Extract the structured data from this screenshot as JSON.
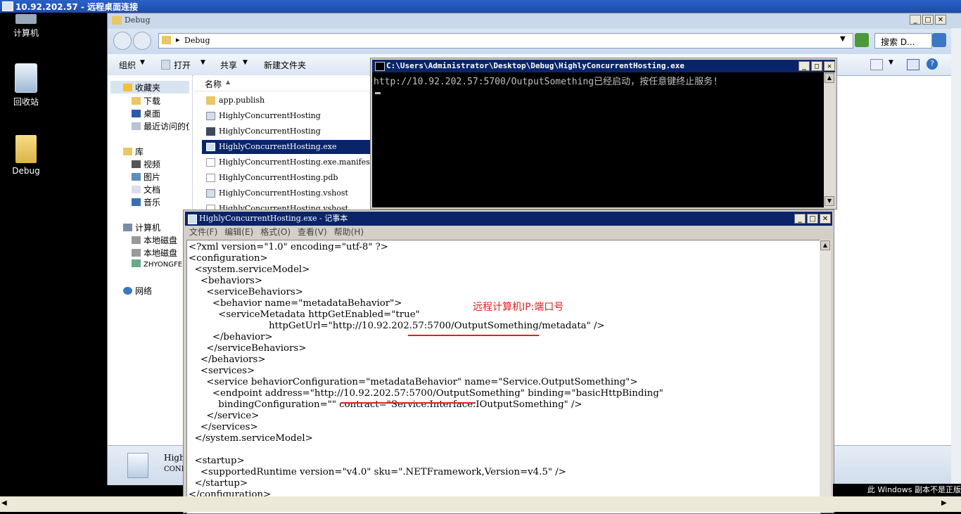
{
  "rdp": {
    "title": "10.92.202.57 - 远程桌面连接"
  },
  "desktop": {
    "icons": [
      {
        "label": "计算机"
      },
      {
        "label": "回收站"
      },
      {
        "label": "Debug"
      }
    ],
    "watermark": "此 Windows 副本不是正版"
  },
  "explorer": {
    "title": "Debug",
    "address": "Debug",
    "search_placeholder": "搜索 D...",
    "commands": [
      "组织",
      "打开",
      "共享",
      "新建文件夹"
    ],
    "column_name": "名称",
    "nav": {
      "favorites": {
        "label": "收藏夹",
        "items": [
          "下载",
          "桌面",
          "最近访问的位置"
        ]
      },
      "library": {
        "label": "库",
        "items": [
          "视频",
          "图片",
          "文档",
          "音乐"
        ]
      },
      "computer": {
        "label": "计算机",
        "items": [
          "本地磁盘",
          "本地磁盘",
          "ZHYONGFEN"
        ]
      },
      "network": {
        "label": "网络"
      }
    },
    "files": [
      {
        "name": "app.publish",
        "type": "folder"
      },
      {
        "name": "HighlyConcurrentHosting",
        "type": "app"
      },
      {
        "name": "HighlyConcurrentHosting",
        "type": "window"
      },
      {
        "name": "HighlyConcurrentHosting.exe",
        "type": "config",
        "selected": true
      },
      {
        "name": "HighlyConcurrentHosting.exe.manifest",
        "type": "file"
      },
      {
        "name": "HighlyConcurrentHosting.pdb",
        "type": "file"
      },
      {
        "name": "HighlyConcurrentHosting.vshost",
        "type": "app"
      },
      {
        "name": "HighlyConcurrentHosting.vshost",
        "type": "file"
      }
    ],
    "details": {
      "name": "High",
      "type": "CONFI"
    }
  },
  "console": {
    "title": "C:\\Users\\Administrator\\Desktop\\Debug\\HighlyConcurrentHosting.exe",
    "output": "http://10.92.202.57:5700/OutputSomething已经启动，按任意键终止服务!"
  },
  "notepad": {
    "title": "HighlyConcurrentHosting.exe - 记事本",
    "menu": [
      "文件(F)",
      "编辑(E)",
      "格式(O)",
      "查看(V)",
      "帮助(H)"
    ],
    "content": "<?xml version=\"1.0\" encoding=\"utf-8\" ?>\n<configuration>\n  <system.serviceModel>\n    <behaviors>\n      <serviceBehaviors>\n        <behavior name=\"metadataBehavior\">\n          <serviceMetadata httpGetEnabled=\"true\"\n                           httpGetUrl=\"http://10.92.202.57:5700/OutputSomething/metadata\" />\n        </behavior>\n      </serviceBehaviors>\n    </behaviors>\n    <services>\n      <service behaviorConfiguration=\"metadataBehavior\" name=\"Service.OutputSomething\">\n        <endpoint address=\"http://10.92.202.57:5700/OutputSomething\" binding=\"basicHttpBinding\"\n          bindingConfiguration=\"\" contract=\"Service.Interface.IOutputSomething\" />\n      </service>\n    </services>\n  </system.serviceModel>\n\n  <startup>\n    <supportedRuntime version=\"v4.0\" sku=\".NETFramework,Version=v4.5\" />\n  </startup>\n</configuration>",
    "annotation": "远程计算机IP:端口号"
  },
  "colors": {
    "annotation": "#e02020",
    "selection": "#0a246a",
    "console_bg": "#000000"
  }
}
